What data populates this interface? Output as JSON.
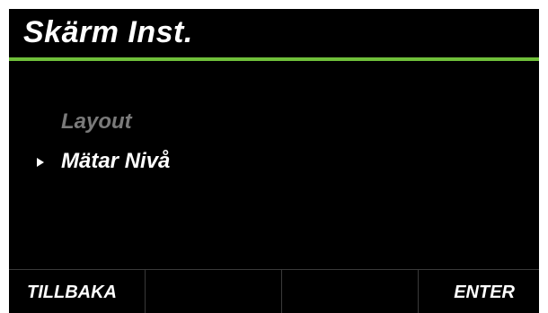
{
  "header": {
    "title": "Skärm Inst."
  },
  "menu": {
    "items": [
      {
        "label": "Layout",
        "state": "disabled"
      },
      {
        "label": "Mätar Nivå",
        "state": "selected"
      }
    ]
  },
  "softkeys": {
    "key1": "TILLBAKA",
    "key2": "",
    "key3": "",
    "key4": "ENTER"
  },
  "colors": {
    "background": "#000000",
    "accent": "#6fbf3a",
    "text": "#ffffff",
    "disabled_text": "#7a7a7a"
  },
  "icons": {
    "cursor": "triangle-right-icon"
  }
}
